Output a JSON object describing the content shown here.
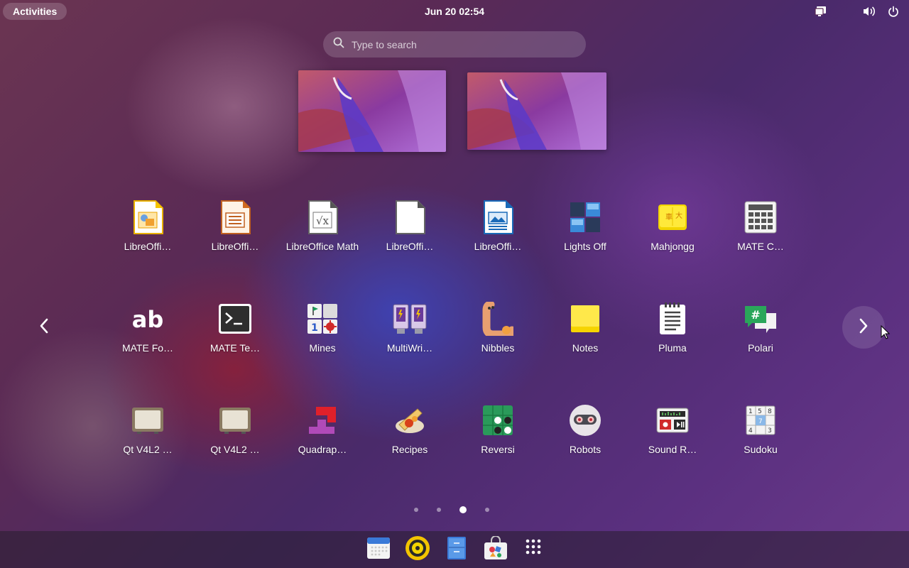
{
  "topbar": {
    "activities_label": "Activities",
    "clock": "Jun 20  02:54",
    "tray_icons": [
      "screen-share-icon",
      "volume-icon",
      "power-icon"
    ]
  },
  "search": {
    "placeholder": "Type to search"
  },
  "apps": [
    {
      "label": "LibreOffi…",
      "icon": "libreoffice-impress-icon"
    },
    {
      "label": "LibreOffi…",
      "icon": "libreoffice-writer-icon"
    },
    {
      "label": "LibreOffice Math",
      "icon": "libreoffice-math-icon"
    },
    {
      "label": "LibreOffi…",
      "icon": "libreoffice-blank-icon"
    },
    {
      "label": "LibreOffi…",
      "icon": "libreoffice-draw-icon"
    },
    {
      "label": "Lights Off",
      "icon": "lights-off-icon"
    },
    {
      "label": "Mahjongg",
      "icon": "mahjongg-icon"
    },
    {
      "label": "MATE C…",
      "icon": "mate-calculator-icon"
    },
    {
      "label": "MATE Fo…",
      "icon": "mate-font-icon"
    },
    {
      "label": "MATE Te…",
      "icon": "mate-terminal-icon"
    },
    {
      "label": "Mines",
      "icon": "mines-icon"
    },
    {
      "label": "MultiWri…",
      "icon": "multiwriter-icon"
    },
    {
      "label": "Nibbles",
      "icon": "nibbles-icon"
    },
    {
      "label": "Notes",
      "icon": "notes-icon"
    },
    {
      "label": "Pluma",
      "icon": "pluma-icon"
    },
    {
      "label": "Polari",
      "icon": "polari-icon"
    },
    {
      "label": "Qt V4L2 …",
      "icon": "qt-v4l2-icon"
    },
    {
      "label": "Qt V4L2 …",
      "icon": "qt-v4l2-icon"
    },
    {
      "label": "Quadrap…",
      "icon": "quadrapassel-icon"
    },
    {
      "label": "Recipes",
      "icon": "recipes-icon"
    },
    {
      "label": "Reversi",
      "icon": "reversi-icon"
    },
    {
      "label": "Robots",
      "icon": "robots-icon"
    },
    {
      "label": "Sound R…",
      "icon": "sound-recorder-icon"
    },
    {
      "label": "Sudoku",
      "icon": "sudoku-icon"
    }
  ],
  "pager": {
    "pages": 4,
    "current": 3
  },
  "dash": [
    "calendar-icon",
    "rhythmbox-icon",
    "files-icon",
    "software-icon",
    "show-apps-icon"
  ]
}
